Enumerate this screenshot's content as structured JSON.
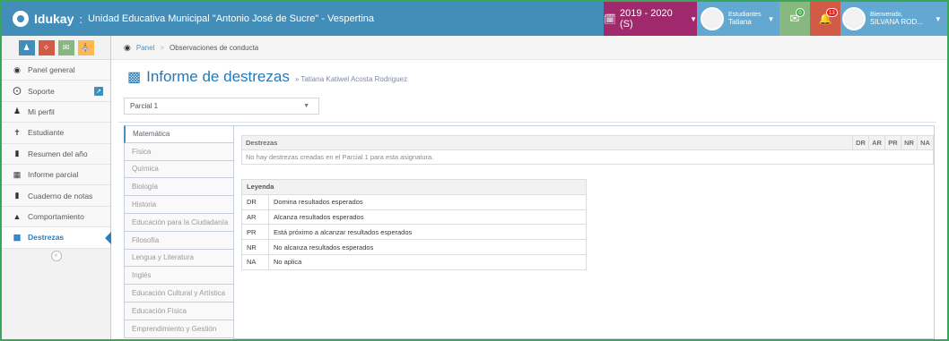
{
  "topbar": {
    "brand": "Idukay",
    "separator": ":",
    "school": "Unidad Educativa Municipal \"Antonio José de Sucre\" - Vespertina",
    "year": "2019 - 2020 (S)",
    "student_role": "Estudiantes",
    "student_name": "Tatiana",
    "messages_count": "0",
    "notifications_count": "13",
    "welcome": "Bienvenido,",
    "user_name": "SILVANA ROD..."
  },
  "sidebar": {
    "items": [
      {
        "label": "Panel general"
      },
      {
        "label": "Soporte"
      },
      {
        "label": "Mi perfil"
      },
      {
        "label": "Estudiante"
      },
      {
        "label": "Resumen del año"
      },
      {
        "label": "Informe parcial"
      },
      {
        "label": "Cuaderno de notas"
      },
      {
        "label": "Comportamiento"
      },
      {
        "label": "Destrezas"
      }
    ],
    "collapse": "«"
  },
  "breadcrumb": {
    "root": "Panel",
    "sep": ">",
    "current": "Observaciones de conducta"
  },
  "header": {
    "title": "Informe de destrezas",
    "subtitle": "» Tatiana Katiwel Acosta Rodriguez"
  },
  "partial_select": {
    "value": "Parcial 1"
  },
  "subjects": [
    "Matemática",
    "Física",
    "Química",
    "Biología",
    "Historia",
    "Educación para la Ciudadanía",
    "Filosofía",
    "Lengua y Literatura",
    "Inglés",
    "Educación Cultural y Artística",
    "Educación Física",
    "Emprendimiento y Gestión"
  ],
  "skills_table": {
    "header": "Destrezas",
    "codes": [
      "DR",
      "AR",
      "PR",
      "NR",
      "NA"
    ],
    "empty_message": "No hay destrezas creadas en el Parcial 1 para esta asignatura."
  },
  "legend": {
    "header": "Leyenda",
    "rows": [
      {
        "code": "DR",
        "desc": "Domina resultados esperados"
      },
      {
        "code": "AR",
        "desc": "Alcanza resultados esperados"
      },
      {
        "code": "PR",
        "desc": "Está próximo a alcanzar resultados esperados"
      },
      {
        "code": "NR",
        "desc": "No alcanza resultados esperados"
      },
      {
        "code": "NA",
        "desc": "No aplica"
      }
    ]
  },
  "colors": {
    "topbar": "#438eb9",
    "year_button": "#a0286d",
    "messages_button": "#87b87f",
    "notifications_button": "#d15b47",
    "accent": "#2679b5"
  }
}
